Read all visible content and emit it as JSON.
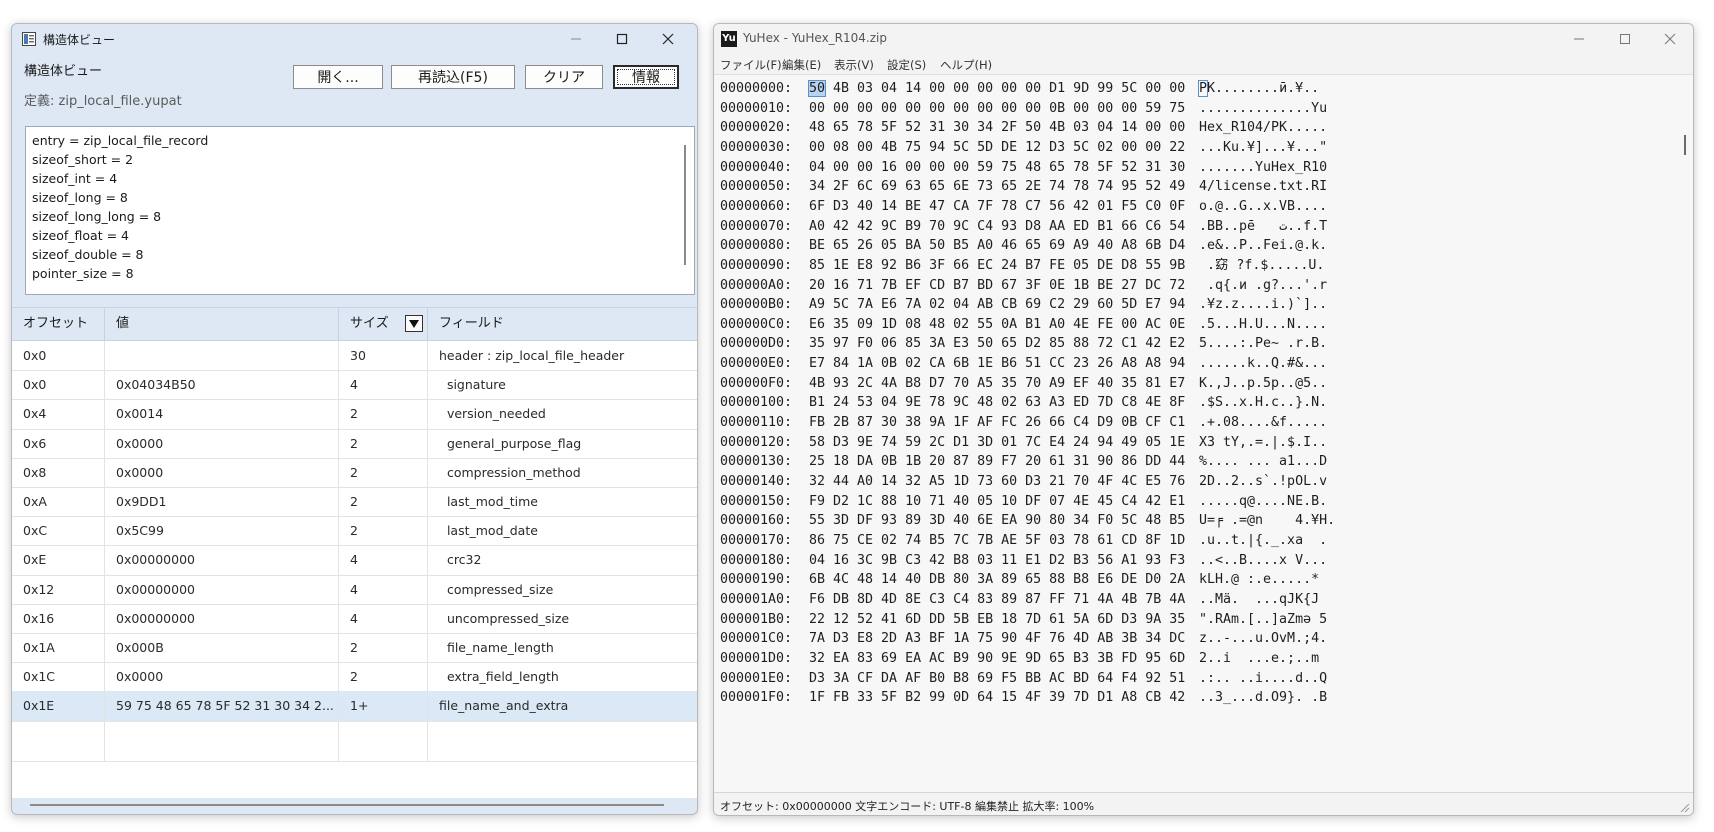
{
  "left_window": {
    "title": "構造体ビュー",
    "header": "構造体ビュー",
    "definition": "定義: zip_local_file.yupat",
    "buttons": {
      "open": "開く...",
      "reload": "再読込(F5)",
      "clear": "クリア",
      "info": "情報"
    },
    "info_lines": [
      "entry = zip_local_file_record",
      "sizeof_short = 2",
      "sizeof_int = 4",
      "sizeof_long = 8",
      "sizeof_long_long = 8",
      "sizeof_float = 4",
      "sizeof_double = 8",
      "pointer_size = 8"
    ],
    "columns": [
      "オフセット",
      "値",
      "サイズ",
      "フィールド"
    ],
    "rows": [
      {
        "offset": "0x0",
        "value": "",
        "size": "30",
        "field": "header : zip_local_file_header"
      },
      {
        "offset": "0x0",
        "value": "0x04034B50",
        "size": "4",
        "field": "  signature"
      },
      {
        "offset": "0x4",
        "value": "0x0014",
        "size": "2",
        "field": "  version_needed"
      },
      {
        "offset": "0x6",
        "value": "0x0000",
        "size": "2",
        "field": "  general_purpose_flag"
      },
      {
        "offset": "0x8",
        "value": "0x0000",
        "size": "2",
        "field": "  compression_method"
      },
      {
        "offset": "0xA",
        "value": "0x9DD1",
        "size": "2",
        "field": "  last_mod_time"
      },
      {
        "offset": "0xC",
        "value": "0x5C99",
        "size": "2",
        "field": "  last_mod_date"
      },
      {
        "offset": "0xE",
        "value": "0x00000000",
        "size": "4",
        "field": "  crc32"
      },
      {
        "offset": "0x12",
        "value": "0x00000000",
        "size": "4",
        "field": "  compressed_size"
      },
      {
        "offset": "0x16",
        "value": "0x00000000",
        "size": "4",
        "field": "  uncompressed_size"
      },
      {
        "offset": "0x1A",
        "value": "0x000B",
        "size": "2",
        "field": "  file_name_length"
      },
      {
        "offset": "0x1C",
        "value": "0x0000",
        "size": "2",
        "field": "  extra_field_length"
      },
      {
        "offset": "0x1E",
        "value": "59 75 48 65 78 5F 52 31 30 34 2...",
        "size": "1+",
        "field": "file_name_and_extra"
      }
    ],
    "selected_row": 12
  },
  "right_window": {
    "title": "YuHex - YuHex_R104.zip",
    "app_icon_text": "Yu",
    "menu": [
      "ファイル(F)",
      "編集(E)",
      "表示(V)",
      "設定(S)",
      "ヘルプ(H)"
    ],
    "hex_rows": [
      {
        "off": "00000000:",
        "hex": "50 4B 03 04 14 00 00 00 00 00 D1 9D 99 5C 00 00",
        "ascii": "PK........ӣ.¥.."
      },
      {
        "off": "00000010:",
        "hex": "00 00 00 00 00 00 00 00 00 00 0B 00 00 00 59 75",
        "ascii": "..............Yu"
      },
      {
        "off": "00000020:",
        "hex": "48 65 78 5F 52 31 30 34 2F 50 4B 03 04 14 00 00",
        "ascii": "Hex_R104/PK....."
      },
      {
        "off": "00000030:",
        "hex": "00 08 00 4B 75 94 5C 5D DE 12 D3 5C 02 00 00 22",
        "ascii": "...Ku.¥]...¥...\""
      },
      {
        "off": "00000040:",
        "hex": "04 00 00 16 00 00 00 59 75 48 65 78 5F 52 31 30",
        "ascii": ".......YuHex_R10"
      },
      {
        "off": "00000050:",
        "hex": "34 2F 6C 69 63 65 6E 73 65 2E 74 78 74 95 52 49",
        "ascii": "4/license.txt.RI"
      },
      {
        "off": "00000060:",
        "hex": "6F D3 40 14 BE 47 CA 7F 78 C7 56 42 01 F5 C0 0F",
        "ascii": "o.@..G..x.VB...."
      },
      {
        "off": "00000070:",
        "hex": "A0 42 42 9C B9 70 9C C4 93 D8 AA ED B1 66 C6 54",
        "ascii": ".BB..pē   ت..f.T"
      },
      {
        "off": "00000080:",
        "hex": "BE 65 26 05 BA 50 B5 A0 46 65 69 A9 40 A8 6B D4",
        "ascii": ".e&..P..Fei.@.k."
      },
      {
        "off": "00000090:",
        "hex": "85 1E E8 92 B6 3F 66 EC 24 B7 FE 05 DE D8 55 9B",
        "ascii": " .窈 ?f.$.....U."
      },
      {
        "off": "000000A0:",
        "hex": "20 16 71 7B EF CD B7 BD 67 3F 0E 1B BE 27 DC 72",
        "ascii": " .q{.и .g?...'.r"
      },
      {
        "off": "000000B0:",
        "hex": "A9 5C 7A E6 7A 02 04 AB CB 69 C2 29 60 5D E7 94",
        "ascii": ".¥z.z....i.)`].."
      },
      {
        "off": "000000C0:",
        "hex": "E6 35 09 1D 08 48 02 55 0A B1 A0 4E FE 00 AC 0E",
        "ascii": ".5...H.U...N...."
      },
      {
        "off": "000000D0:",
        "hex": "35 97 F0 06 85 3A E3 50 65 D2 85 88 72 C1 42 E2",
        "ascii": "5....:.Pe~ .r.B."
      },
      {
        "off": "000000E0:",
        "hex": "E7 84 1A 0B 02 CA 6B 1E B6 51 CC 23 26 A8 A8 94",
        "ascii": "......k..Q.#&..."
      },
      {
        "off": "000000F0:",
        "hex": "4B 93 2C 4A B8 D7 70 A5 35 70 A9 EF 40 35 81 E7",
        "ascii": "K.,J..p.5p..@5.."
      },
      {
        "off": "00000100:",
        "hex": "B1 24 53 04 9E 78 9C 48 02 63 A3 ED 7D C8 4E 8F",
        "ascii": ".$S..x.H.c..}.N."
      },
      {
        "off": "00000110:",
        "hex": "FB 2B 87 30 38 9A 1F AF FC 26 66 C4 D9 0B CF C1",
        "ascii": ".+.08....&f....."
      },
      {
        "off": "00000120:",
        "hex": "58 D3 9E 74 59 2C D1 3D 01 7C E4 24 94 49 05 1E",
        "ascii": "X3 tY,.=.|.$.I.."
      },
      {
        "off": "00000130:",
        "hex": "25 18 DA 0B 1B 20 87 89 F7 20 61 31 90 86 DD 44",
        "ascii": "%.... ... a1...D"
      },
      {
        "off": "00000140:",
        "hex": "32 44 A0 14 32 A5 1D 73 60 D3 21 70 4F 4C E5 76",
        "ascii": "2D..2..s`.!pOL.v"
      },
      {
        "off": "00000150:",
        "hex": "F9 D2 1C 88 10 71 40 05 10 DF 07 4E 45 C4 42 E1",
        "ascii": ".....q@....NE.B."
      },
      {
        "off": "00000160:",
        "hex": "55 3D DF 93 89 3D 40 6E EA 90 80 34 F0 5C 48 B5",
        "ascii": "U=╒ .=@n    4.¥H."
      },
      {
        "off": "00000170:",
        "hex": "86 75 CE 02 74 B5 7C 7B AE 5F 03 78 61 CD 8F 1D",
        "ascii": ".u..t.|{._.xa  ."
      },
      {
        "off": "00000180:",
        "hex": "04 16 3C 9B C3 42 B8 03 11 E1 D2 B3 56 A1 93 F3",
        "ascii": "..<..B....x V..."
      },
      {
        "off": "00000190:",
        "hex": "6B 4C 48 14 40 DB 80 3A 89 65 88 B8 E6 DE D0 2A",
        "ascii": "kLH.@ :.e.....*"
      },
      {
        "off": "000001A0:",
        "hex": "F6 DB 8D 4D 8E C3 C4 83 89 87 FF 71 4A 4B 7B 4A",
        "ascii": "..Mä.  ...qJK{J"
      },
      {
        "off": "000001B0:",
        "hex": "22 12 52 41 6D DD 5B EB 18 7D 61 5A 6D D3 9A 35",
        "ascii": "\".RAm.[..]aZmə 5"
      },
      {
        "off": "000001C0:",
        "hex": "7A D3 E8 2D A3 BF 1A 75 90 4F 76 4D AB 3B 34 DC",
        "ascii": "z..-...u.OvM.;4."
      },
      {
        "off": "000001D0:",
        "hex": "32 EA 83 69 EA AC B9 90 9E 9D 65 B3 3B FD 95 6D",
        "ascii": "2..i  ...e.;..m"
      },
      {
        "off": "000001E0:",
        "hex": "D3 3A CF DA AF B0 B8 69 F5 BB AC BD 64 F4 92 51",
        "ascii": ".:.. ..i....d..Q"
      },
      {
        "off": "000001F0:",
        "hex": "1F FB 33 5F B2 99 0D 64 15 4F 39 7D D1 A8 CB 42",
        "ascii": "..3_...d.O9}. .B"
      }
    ],
    "status": "オフセット: 0x00000000  文字エンコード: UTF-8  編集禁止  拡大率: 100%"
  }
}
